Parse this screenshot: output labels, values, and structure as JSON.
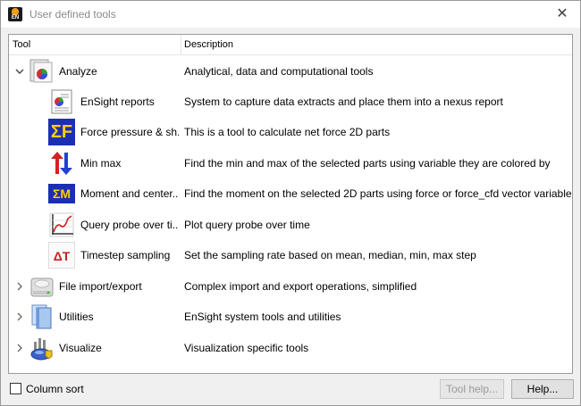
{
  "window": {
    "title": "User defined tools",
    "close_glyph": "✕",
    "app_icon_text": "EN"
  },
  "tree": {
    "columns": {
      "tool": "Tool",
      "description": "Description"
    },
    "rows": [
      {
        "label": "Analyze",
        "description": "Analytical, data and computational tools",
        "icon": "analyze-folder-icon",
        "expanded": true
      },
      {
        "label": "EnSight reports",
        "description": "System to capture data extracts and place them into a nexus report",
        "icon": "report-icon"
      },
      {
        "label": "Force pressure & sh...",
        "description": "This is a tool to calculate net force 2D parts",
        "icon": "sigma-f-icon",
        "icon_text": "ΣF"
      },
      {
        "label": "Min max",
        "description": "Find the min and max of the selected parts using variable they are colored by",
        "icon": "min-max-arrows-icon"
      },
      {
        "label": "Moment and center...",
        "description": "Find the moment on the selected 2D parts using force or force_cfd vector variable",
        "icon": "sigma-m-icon",
        "icon_text": "ΣM"
      },
      {
        "label": "Query probe over ti...",
        "description": "Plot query probe over time",
        "icon": "probe-plot-icon"
      },
      {
        "label": "Timestep sampling",
        "description": "Set the sampling rate based on mean, median, min, max step",
        "icon": "delta-t-icon",
        "icon_text": "ΔT"
      },
      {
        "label": "File import/export",
        "description": "Complex import and export operations, simplified",
        "icon": "drive-icon",
        "expanded": false
      },
      {
        "label": "Utilities",
        "description": "EnSight system tools and utilities",
        "icon": "utilities-folder-icon",
        "expanded": false
      },
      {
        "label": "Visualize",
        "description": "Visualization specific tools",
        "icon": "visualize-icon",
        "expanded": false
      }
    ]
  },
  "footer": {
    "column_sort_label": "Column sort",
    "tool_help_label": "Tool help...",
    "help_label": "Help..."
  },
  "colors": {
    "sigma_bg": "#1c2fb3",
    "sigma_fg": "#ffd000",
    "delta_t": "#cc2020",
    "arrow_red": "#d42020",
    "arrow_blue": "#2040d0"
  }
}
